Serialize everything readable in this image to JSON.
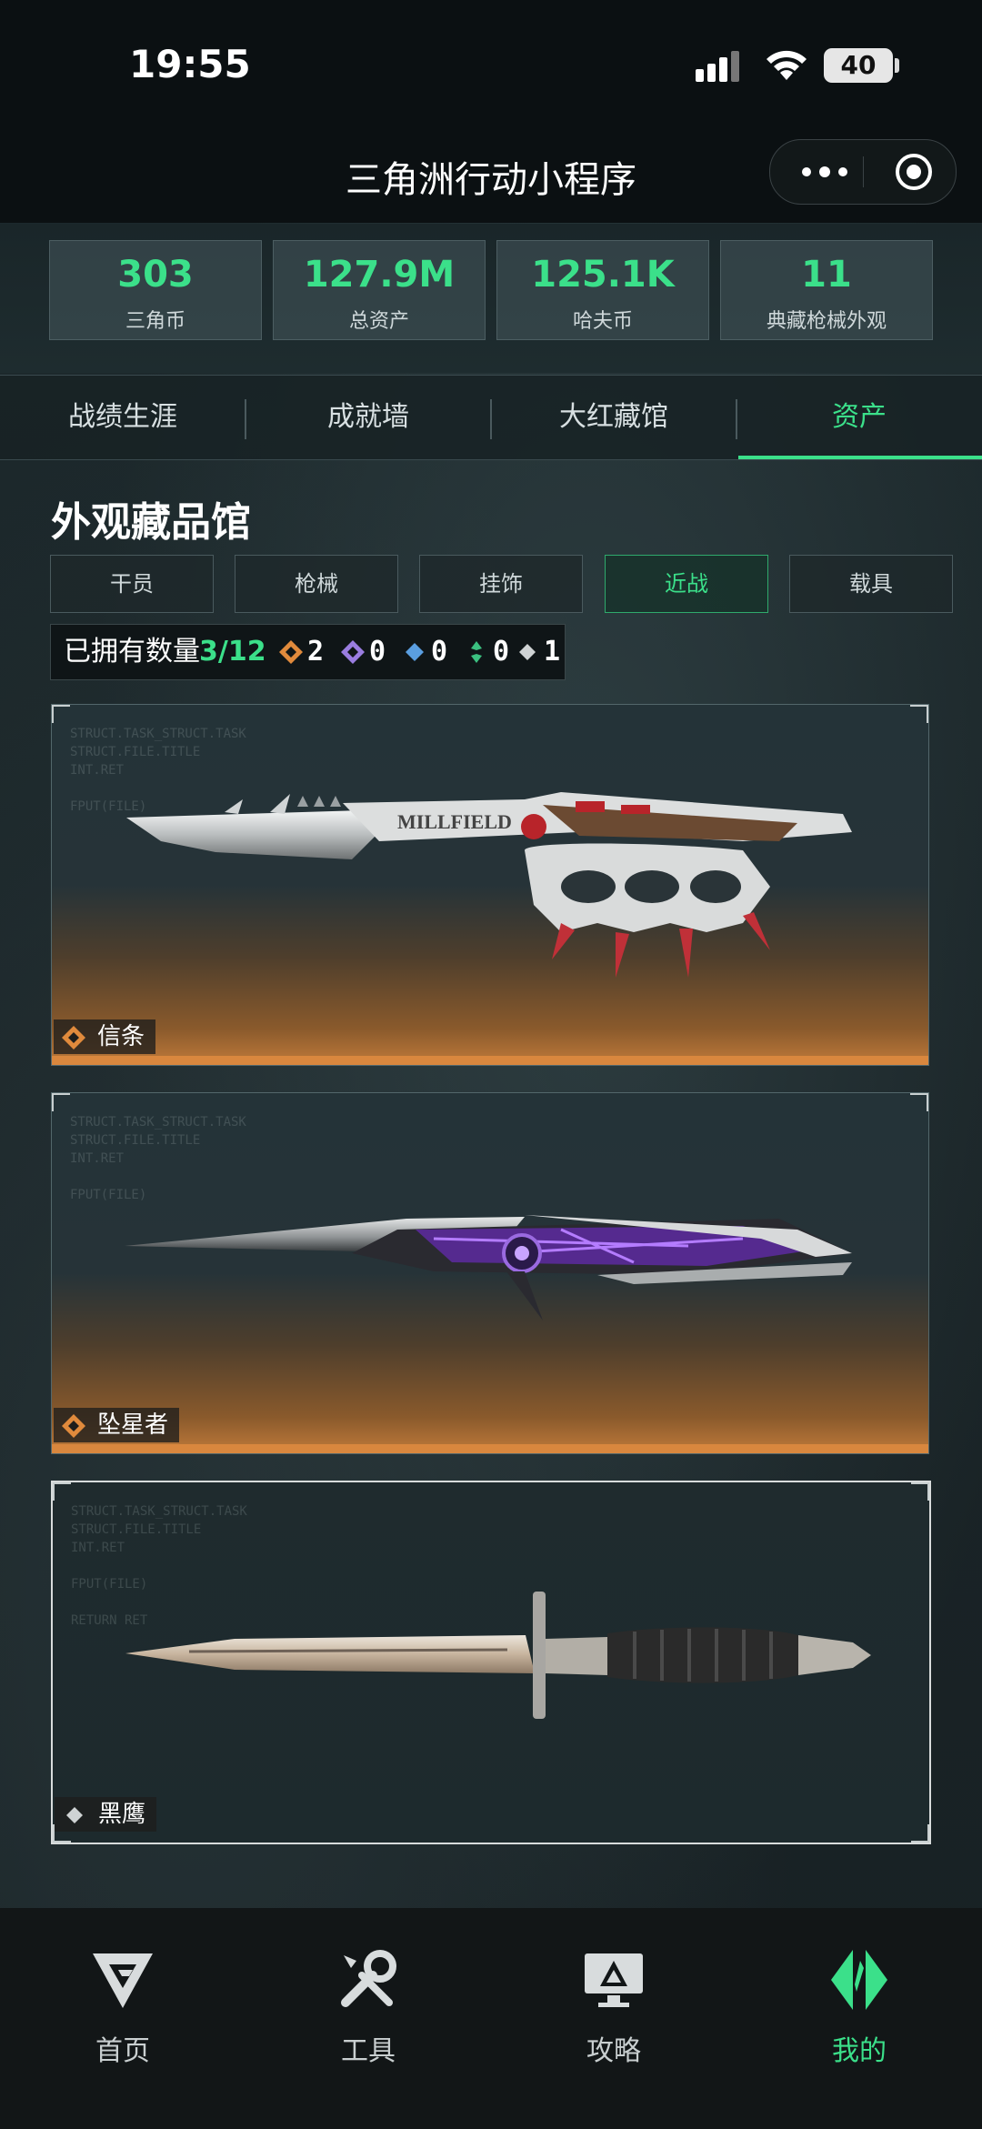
{
  "status_bar": {
    "time": "19:55",
    "battery": "40"
  },
  "app": {
    "title": "三角洲行动小程序"
  },
  "stats": [
    {
      "value": "303",
      "label": "三角币"
    },
    {
      "value": "127.9M",
      "label": "总资产"
    },
    {
      "value": "125.1K",
      "label": "哈夫币"
    },
    {
      "value": "11",
      "label": "典藏枪械外观"
    }
  ],
  "tabs": [
    {
      "label": "战绩生涯"
    },
    {
      "label": "成就墙"
    },
    {
      "label": "大红藏馆"
    },
    {
      "label": "资产"
    }
  ],
  "section": {
    "title": "外观藏品馆"
  },
  "filters": [
    {
      "label": "干员"
    },
    {
      "label": "枪械"
    },
    {
      "label": "挂饰"
    },
    {
      "label": "近战"
    },
    {
      "label": "载具"
    }
  ],
  "owned": {
    "label": "已拥有数量",
    "count": "3/12",
    "rarities": [
      {
        "icon": "gold-rarity-icon",
        "count": "2",
        "color": "#e08a3c"
      },
      {
        "icon": "purple-rarity-icon",
        "count": "0",
        "color": "#9a7de0"
      },
      {
        "icon": "blue-rarity-icon",
        "count": "0",
        "color": "#5a9ee0"
      },
      {
        "icon": "green-rarity-icon",
        "count": "0",
        "color": "#3bc080"
      },
      {
        "icon": "white-rarity-icon",
        "count": "1",
        "color": "#cfd3d4"
      }
    ]
  },
  "items": [
    {
      "name": "信条",
      "rarity": "gold",
      "blade_text": "MILLFIELD"
    },
    {
      "name": "坠星者",
      "rarity": "gold"
    },
    {
      "name": "黑鹰",
      "rarity": "white"
    }
  ],
  "bottom_nav": [
    {
      "label": "首页",
      "icon": "home-logo-icon"
    },
    {
      "label": "工具",
      "icon": "tools-icon"
    },
    {
      "label": "攻略",
      "icon": "guide-icon"
    },
    {
      "label": "我的",
      "icon": "profile-icon"
    }
  ],
  "colors": {
    "accent": "#3be08a",
    "gold": "#e08a3c"
  }
}
